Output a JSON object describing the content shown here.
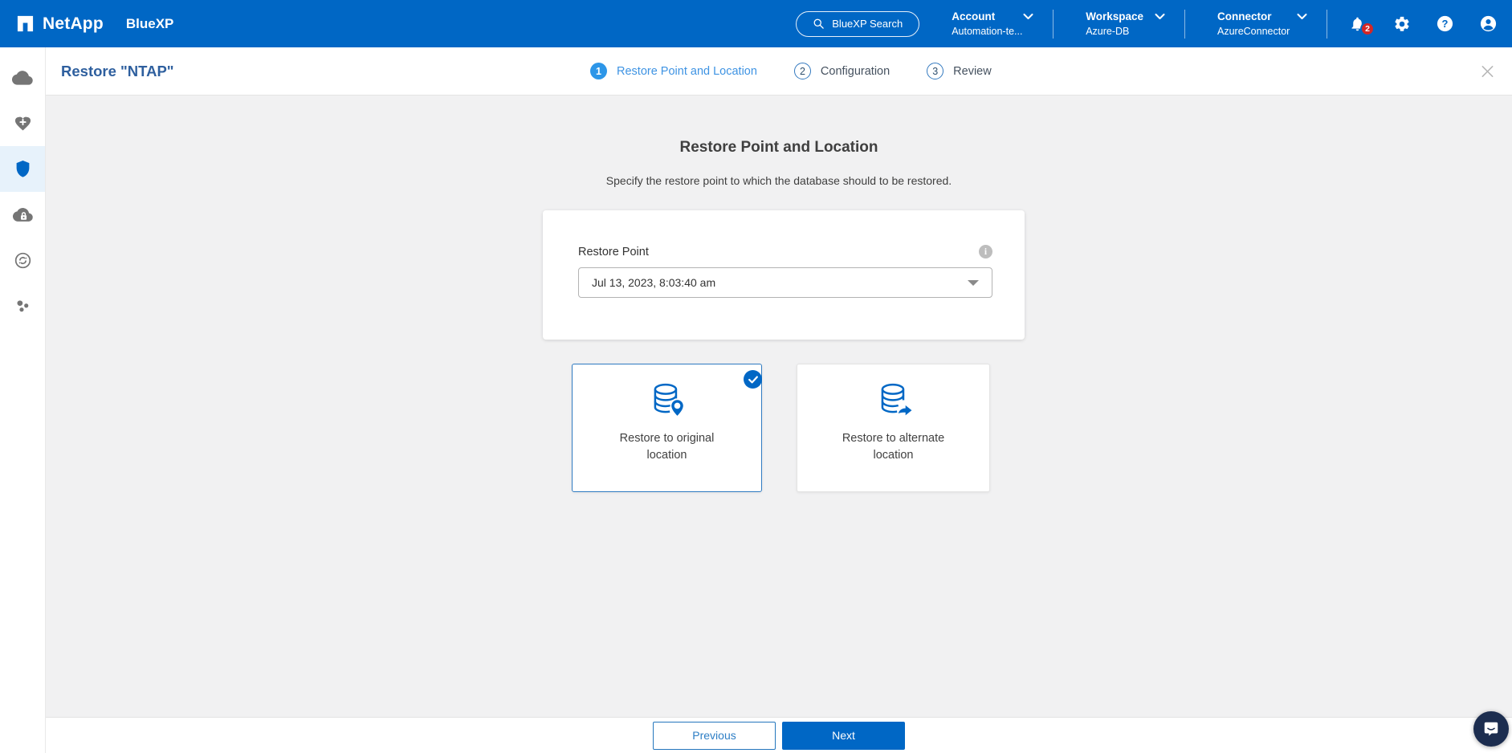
{
  "topbar": {
    "brand": "NetApp",
    "product": "BlueXP",
    "search": {
      "label": "BlueXP Search",
      "icon": "search-icon"
    },
    "menus": [
      {
        "label": "Account",
        "value": "Automation-te...",
        "icon": "chevron-down-icon"
      },
      {
        "label": "Workspace",
        "value": "Azure-DB",
        "icon": "chevron-down-icon"
      },
      {
        "label": "Connector",
        "value": "AzureConnector",
        "icon": "chevron-down-icon"
      }
    ],
    "notifications": {
      "icon": "bell-icon",
      "badge": "2"
    },
    "action_icons": [
      "settings-gear-icon",
      "help-icon",
      "user-avatar-icon"
    ]
  },
  "sidebar": {
    "icons": [
      "cloud-icon",
      "heart-plus-icon",
      "shield-icon",
      "cloud-lock-icon",
      "sync-circle-icon",
      "cluster-dots-icon"
    ],
    "active_icon": "shield-icon"
  },
  "wizard": {
    "title": "Restore \"NTAP\"",
    "steps": [
      {
        "number": "1",
        "label": "Restore Point and Location",
        "state": "active"
      },
      {
        "number": "2",
        "label": "Configuration",
        "state": "upcoming"
      },
      {
        "number": "3",
        "label": "Review",
        "state": "upcoming"
      }
    ],
    "close_icon": "close-icon"
  },
  "main": {
    "heading": "Restore Point and Location",
    "subheading": "Specify the restore point to which the database should to be restored.",
    "restore_point": {
      "label": "Restore Point",
      "value": "Jul 13, 2023, 8:03:40 am",
      "info_icon": "info-icon"
    },
    "location_options": [
      {
        "label": "Restore to original location",
        "icon": "database-pin-icon",
        "selected": true
      },
      {
        "label": "Restore to alternate location",
        "icon": "database-arrow-icon",
        "selected": false
      }
    ]
  },
  "footer": {
    "previous": "Previous",
    "next": "Next"
  },
  "chat": {
    "icon": "chat-bubble-icon"
  },
  "colors": {
    "header_blue": "#0067C5",
    "active_step_blue": "#2d96e8",
    "step_label_blue": "#3e93e3",
    "title_blue": "#2e5f9e",
    "selected_border_blue": "#2f7bc2",
    "badge_red": "#d32727",
    "content_bg": "#f1f1f2",
    "chat_navy": "#1c2d4f"
  }
}
